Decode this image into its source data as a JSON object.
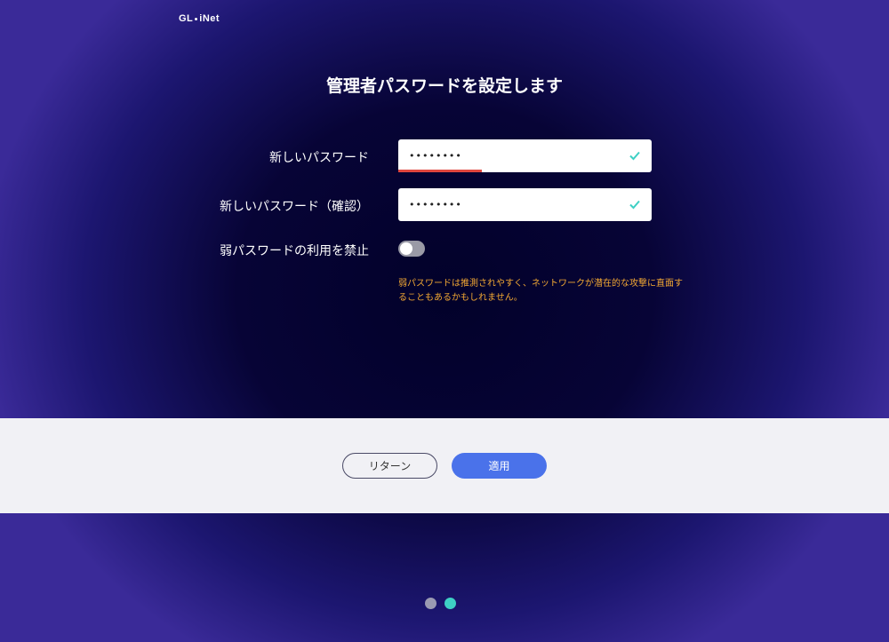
{
  "brand": {
    "logo_left": "GL",
    "logo_right": "iNet"
  },
  "page_title": "管理者パスワードを設定します",
  "form": {
    "new_password": {
      "label": "新しいパスワード",
      "value": "••••••••"
    },
    "confirm_password": {
      "label": "新しいパスワード（確認）",
      "value": "••••••••"
    },
    "weak_password_toggle": {
      "label": "弱パスワードの利用を禁止",
      "checked": false
    },
    "warning": "弱パスワードは推測されやすく、ネットワークが潜在的な攻撃に直面することもあるかもしれません。"
  },
  "buttons": {
    "return_label": "リターン",
    "apply_label": "適用"
  },
  "pagination": {
    "total": 2,
    "active": 2
  },
  "colors": {
    "accent": "#4a72ea",
    "valid": "#3ed0c4",
    "warning": "#f2a833",
    "strength": "#e0463e"
  }
}
